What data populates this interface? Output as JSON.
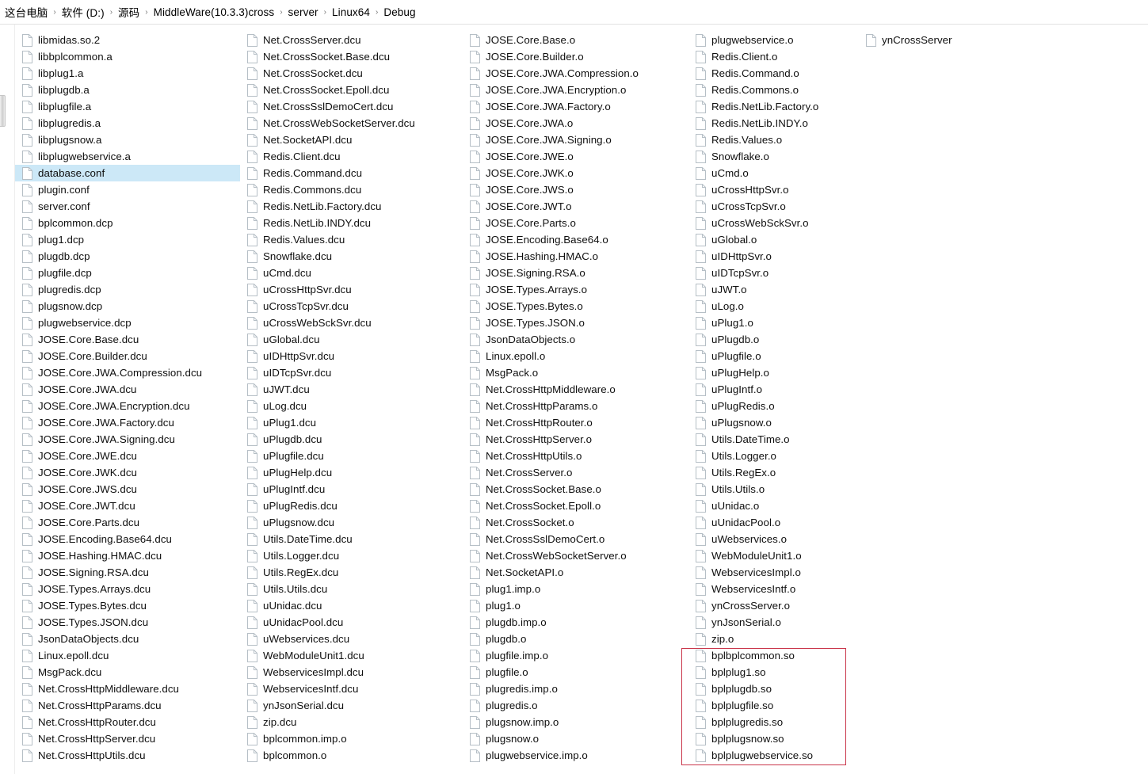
{
  "breadcrumb": {
    "separator": "›",
    "crumbs": [
      "这台电脑",
      "软件 (D:)",
      "源码",
      "MiddleWare(10.3.3)cross",
      "server",
      "Linux64",
      "Debug"
    ]
  },
  "icons": {
    "file": "file-icon",
    "splitter": "splitter-handle-icon"
  },
  "selection": {
    "selected_file": "database.conf",
    "highlight_color": "#cce8f7"
  },
  "annotation": {
    "color": "#c9354a",
    "encloses_from": "bplbplcommon.so",
    "encloses_to": "bplplugwebservice.so"
  },
  "columns": [
    {
      "index": 1,
      "items": [
        "libmidas.so.2",
        "libbplcommon.a",
        "libplug1.a",
        "libplugdb.a",
        "libplugfile.a",
        "libplugredis.a",
        "libplugsnow.a",
        "libplugwebservice.a",
        "database.conf",
        "plugin.conf",
        "server.conf",
        "bplcommon.dcp",
        "plug1.dcp",
        "plugdb.dcp",
        "plugfile.dcp",
        "plugredis.dcp",
        "plugsnow.dcp",
        "plugwebservice.dcp",
        "JOSE.Core.Base.dcu",
        "JOSE.Core.Builder.dcu",
        "JOSE.Core.JWA.Compression.dcu",
        "JOSE.Core.JWA.dcu",
        "JOSE.Core.JWA.Encryption.dcu",
        "JOSE.Core.JWA.Factory.dcu",
        "JOSE.Core.JWA.Signing.dcu",
        "JOSE.Core.JWE.dcu",
        "JOSE.Core.JWK.dcu",
        "JOSE.Core.JWS.dcu",
        "JOSE.Core.JWT.dcu",
        "JOSE.Core.Parts.dcu",
        "JOSE.Encoding.Base64.dcu",
        "JOSE.Hashing.HMAC.dcu",
        "JOSE.Signing.RSA.dcu",
        "JOSE.Types.Arrays.dcu",
        "JOSE.Types.Bytes.dcu",
        "JOSE.Types.JSON.dcu",
        "JsonDataObjects.dcu",
        "Linux.epoll.dcu",
        "MsgPack.dcu",
        "Net.CrossHttpMiddleware.dcu",
        "Net.CrossHttpParams.dcu",
        "Net.CrossHttpRouter.dcu",
        "Net.CrossHttpServer.dcu",
        "Net.CrossHttpUtils.dcu"
      ]
    },
    {
      "index": 2,
      "items": [
        "Net.CrossServer.dcu",
        "Net.CrossSocket.Base.dcu",
        "Net.CrossSocket.dcu",
        "Net.CrossSocket.Epoll.dcu",
        "Net.CrossSslDemoCert.dcu",
        "Net.CrossWebSocketServer.dcu",
        "Net.SocketAPI.dcu",
        "Redis.Client.dcu",
        "Redis.Command.dcu",
        "Redis.Commons.dcu",
        "Redis.NetLib.Factory.dcu",
        "Redis.NetLib.INDY.dcu",
        "Redis.Values.dcu",
        "Snowflake.dcu",
        "uCmd.dcu",
        "uCrossHttpSvr.dcu",
        "uCrossTcpSvr.dcu",
        "uCrossWebSckSvr.dcu",
        "uGlobal.dcu",
        "uIDHttpSvr.dcu",
        "uIDTcpSvr.dcu",
        "uJWT.dcu",
        "uLog.dcu",
        "uPlug1.dcu",
        "uPlugdb.dcu",
        "uPlugfile.dcu",
        "uPlugHelp.dcu",
        "uPlugIntf.dcu",
        "uPlugRedis.dcu",
        "uPlugsnow.dcu",
        "Utils.DateTime.dcu",
        "Utils.Logger.dcu",
        "Utils.RegEx.dcu",
        "Utils.Utils.dcu",
        "uUnidac.dcu",
        "uUnidacPool.dcu",
        "uWebservices.dcu",
        "WebModuleUnit1.dcu",
        "WebservicesImpl.dcu",
        "WebservicesIntf.dcu",
        "ynJsonSerial.dcu",
        "zip.dcu",
        "bplcommon.imp.o",
        "bplcommon.o"
      ]
    },
    {
      "index": 3,
      "items": [
        "JOSE.Core.Base.o",
        "JOSE.Core.Builder.o",
        "JOSE.Core.JWA.Compression.o",
        "JOSE.Core.JWA.Encryption.o",
        "JOSE.Core.JWA.Factory.o",
        "JOSE.Core.JWA.o",
        "JOSE.Core.JWA.Signing.o",
        "JOSE.Core.JWE.o",
        "JOSE.Core.JWK.o",
        "JOSE.Core.JWS.o",
        "JOSE.Core.JWT.o",
        "JOSE.Core.Parts.o",
        "JOSE.Encoding.Base64.o",
        "JOSE.Hashing.HMAC.o",
        "JOSE.Signing.RSA.o",
        "JOSE.Types.Arrays.o",
        "JOSE.Types.Bytes.o",
        "JOSE.Types.JSON.o",
        "JsonDataObjects.o",
        "Linux.epoll.o",
        "MsgPack.o",
        "Net.CrossHttpMiddleware.o",
        "Net.CrossHttpParams.o",
        "Net.CrossHttpRouter.o",
        "Net.CrossHttpServer.o",
        "Net.CrossHttpUtils.o",
        "Net.CrossServer.o",
        "Net.CrossSocket.Base.o",
        "Net.CrossSocket.Epoll.o",
        "Net.CrossSocket.o",
        "Net.CrossSslDemoCert.o",
        "Net.CrossWebSocketServer.o",
        "Net.SocketAPI.o",
        "plug1.imp.o",
        "plug1.o",
        "plugdb.imp.o",
        "plugdb.o",
        "plugfile.imp.o",
        "plugfile.o",
        "plugredis.imp.o",
        "plugredis.o",
        "plugsnow.imp.o",
        "plugsnow.o",
        "plugwebservice.imp.o"
      ]
    },
    {
      "index": 4,
      "items": [
        "plugwebservice.o",
        "Redis.Client.o",
        "Redis.Command.o",
        "Redis.Commons.o",
        "Redis.NetLib.Factory.o",
        "Redis.NetLib.INDY.o",
        "Redis.Values.o",
        "Snowflake.o",
        "uCmd.o",
        "uCrossHttpSvr.o",
        "uCrossTcpSvr.o",
        "uCrossWebSckSvr.o",
        "uGlobal.o",
        "uIDHttpSvr.o",
        "uIDTcpSvr.o",
        "uJWT.o",
        "uLog.o",
        "uPlug1.o",
        "uPlugdb.o",
        "uPlugfile.o",
        "uPlugHelp.o",
        "uPlugIntf.o",
        "uPlugRedis.o",
        "uPlugsnow.o",
        "Utils.DateTime.o",
        "Utils.Logger.o",
        "Utils.RegEx.o",
        "Utils.Utils.o",
        "uUnidac.o",
        "uUnidacPool.o",
        "uWebservices.o",
        "WebModuleUnit1.o",
        "WebservicesImpl.o",
        "WebservicesIntf.o",
        "ynCrossServer.o",
        "ynJsonSerial.o",
        "zip.o",
        "bplbplcommon.so",
        "bplplug1.so",
        "bplplugdb.so",
        "bplplugfile.so",
        "bplplugredis.so",
        "bplplugsnow.so",
        "bplplugwebservice.so"
      ]
    },
    {
      "index": 5,
      "items": [
        "ynCrossServer"
      ]
    }
  ]
}
